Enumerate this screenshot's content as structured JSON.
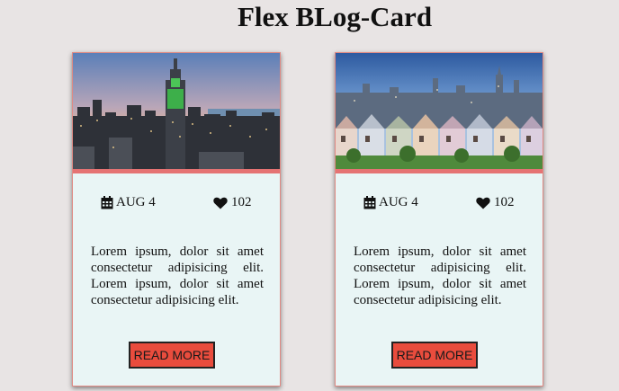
{
  "page": {
    "title": "Flex BLog-Card"
  },
  "cards": [
    {
      "image_alt": "city skyline at dusk",
      "date": "AUG 4",
      "likes": "102",
      "text": "Lorem ipsum, dolor sit amet consectetur adipisicing elit. Lorem ipsum, dolor sit amet consectetur adipisicing elit.",
      "button_label": "READ MORE"
    },
    {
      "image_alt": "row of painted houses with city behind",
      "date": "AUG 4",
      "likes": "102",
      "text": "Lorem ipsum, dolor sit amet consectetur adipisicing elit. Lorem ipsum, dolor sit amet consectetur adipisicing elit.",
      "button_label": "READ MORE"
    }
  ],
  "colors": {
    "background": "#e8e4e4",
    "card_background": "#e9f5f5",
    "card_border": "#e08a84",
    "button": "#e94c3d"
  },
  "icons": {
    "date": "calendar-icon",
    "likes": "heart-icon"
  }
}
